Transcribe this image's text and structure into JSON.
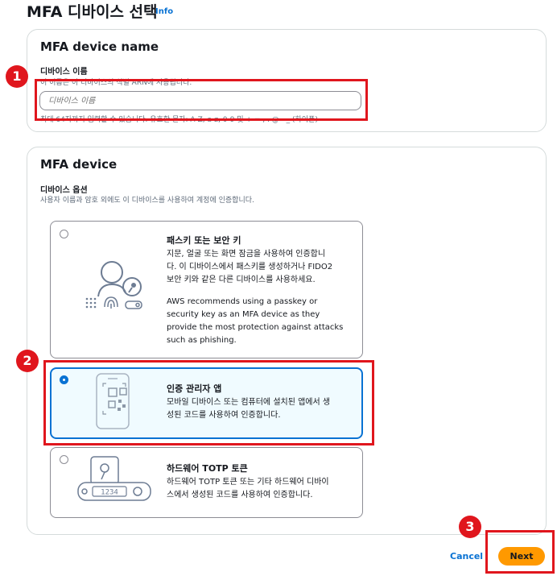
{
  "header": {
    "title": "MFA 디바이스 선택",
    "info": "Info"
  },
  "device_name_section": {
    "title": "MFA device name",
    "field_label": "디바이스 이름",
    "field_desc": "이 이름은 이 디바이스의 식별 ARN에 사용됩니다.",
    "placeholder": "디바이스 이름",
    "hint": "최대 64자까지 입력할 수 있습니다. 유효한 문자: A-Z, a-z, 0-9 및 + = , . @ - _ (하이픈)"
  },
  "device_section": {
    "title": "MFA device",
    "options_label": "디바이스 옵션",
    "options_desc": "사용자 이름과 암호 외에도 이 디바이스를 사용하여 계정에 인증합니다.",
    "options": [
      {
        "title": "패스키 또는 보안 키",
        "desc": [
          "지문, 얼굴 또는 화면 잠금을 사용하여 인증합니",
          "다. 이 디바이스에서 패스키를 생성하거나 FIDO2",
          "보안 키와 같은 다른 디바이스를 사용하세요."
        ],
        "note": [
          "AWS recommends using a passkey or",
          "security key as an MFA device as they",
          "provide the most protection against attacks",
          "such as phishing."
        ],
        "selected": false,
        "icon": "passkey-icon"
      },
      {
        "title": "인증 관리자 앱",
        "desc": [
          "모바일 디바이스 또는 컴퓨터에 설치된 앱에서 생",
          "성된 코드를 사용하여 인증합니다."
        ],
        "selected": true,
        "icon": "authenticator-app-icon"
      },
      {
        "title": "하드웨어 TOTP 토큰",
        "desc": [
          "하드웨어 TOTP 토큰 또는 기타 하드웨어 디바이",
          "스에서 생성된 코드를 사용하여 인증합니다."
        ],
        "selected": false,
        "icon": "hardware-token-icon",
        "token_display": "1234"
      }
    ]
  },
  "annotations": [
    "1",
    "2",
    "3"
  ],
  "footer": {
    "cancel": "Cancel",
    "next": "Next"
  },
  "colors": {
    "accent": "#0972d3",
    "primary_button": "#ff9900",
    "highlight": "#e0161d"
  }
}
